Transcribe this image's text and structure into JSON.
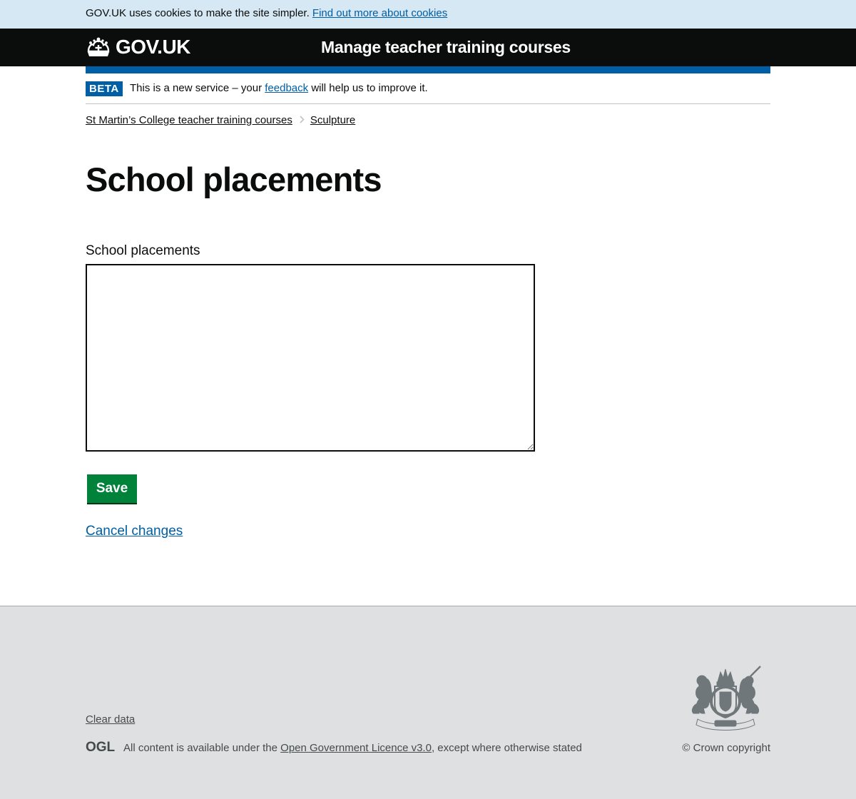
{
  "cookie_banner": {
    "text": "GOV.UK uses cookies to make the site simpler.",
    "link": "Find out more about cookies"
  },
  "header": {
    "logo_text": "GOV.UK",
    "service_name": "Manage teacher training courses",
    "logo_icon": "crown-icon"
  },
  "phase_banner": {
    "tag": "BETA",
    "text_before": "This is a new service – your",
    "link": "feedback",
    "text_after": "will help us to improve it."
  },
  "breadcrumbs": [
    {
      "label": "St Martin’s College teacher training courses"
    },
    {
      "label": "Sculpture"
    }
  ],
  "page": {
    "title": "School placements"
  },
  "form": {
    "field_label": "School placements",
    "field_value": "",
    "save_label": "Save",
    "cancel_label": "Cancel changes"
  },
  "footer": {
    "clear_data": "Clear data",
    "ogl_logo": "OGL",
    "licence_before": "All content is available under the",
    "licence_link": "Open Government Licence v3.0",
    "licence_after": ", except where otherwise stated",
    "copyright": "© Crown copyright",
    "crest_icon": "royal-coat-of-arms-icon"
  },
  "colors": {
    "header_bg": "#0b0c0c",
    "brand_blue": "#005ea5",
    "button_green": "#00823b",
    "footer_bg": "#dee0e2",
    "cookie_bg": "#d5e8f3"
  }
}
